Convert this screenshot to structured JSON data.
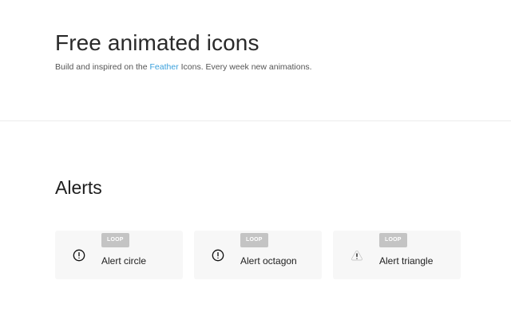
{
  "hero": {
    "title": "Free animated icons",
    "subtitle_before": "Build and inspired on the ",
    "subtitle_link": "Feather",
    "subtitle_after": " Icons. Every week new animations."
  },
  "section": {
    "title": "Alerts"
  },
  "cards": [
    {
      "badge": "LOOP",
      "label": "Alert circle",
      "icon": "alert-circle-icon"
    },
    {
      "badge": "LOOP",
      "label": "Alert octagon",
      "icon": "alert-octagon-icon"
    },
    {
      "badge": "LOOP",
      "label": "Alert triangle",
      "icon": "alert-triangle-icon"
    }
  ],
  "colors": {
    "link": "#3aa0dc",
    "badge_bg": "#c4c4c4",
    "card_bg": "#f7f7f7"
  }
}
